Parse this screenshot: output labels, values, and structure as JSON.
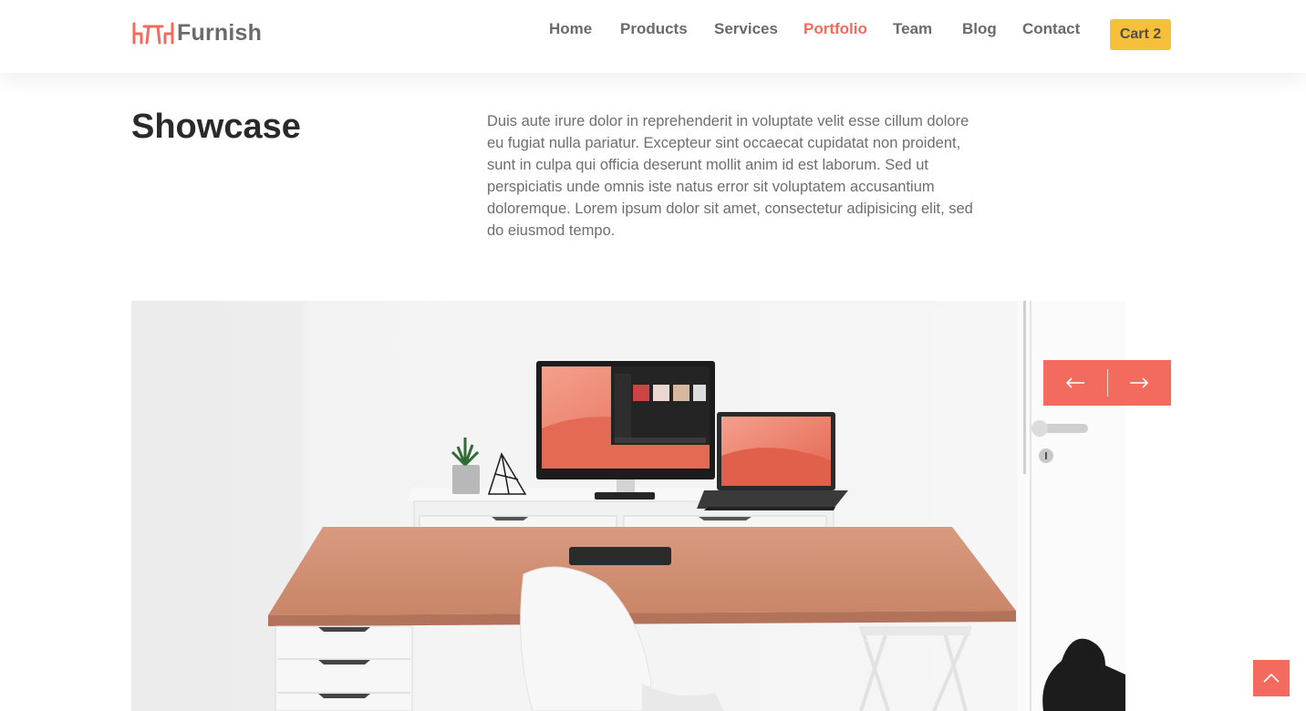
{
  "brand": {
    "name": "Furnish",
    "accent_color": "#f26b5e"
  },
  "nav": {
    "items": [
      {
        "label": "Home",
        "active": false
      },
      {
        "label": "Products",
        "active": false
      },
      {
        "label": "Services",
        "active": false
      },
      {
        "label": "Portfolio",
        "active": true
      },
      {
        "label": "Team",
        "active": false
      },
      {
        "label": "Blog",
        "active": false
      },
      {
        "label": "Contact",
        "active": false
      }
    ],
    "cart_label": "Cart 2",
    "cart_color": "#f7bf3a"
  },
  "section": {
    "title": "Showcase",
    "description": "Duis aute irure dolor in reprehenderit in voluptate velit esse cillum dolore eu fugiat nulla pariatur. Excepteur sint occaecat cupidatat non proident, sunt in culpa qui officia deserunt mollit anim id est laborum. Sed ut perspiciatis unde omnis iste natus error sit voluptatem accusantium doloremque. Lorem ipsum dolor sit amet, consectetur adipisicing elit, sed do eiusmod tempo."
  },
  "slider": {
    "prev_icon": "arrow-left-icon",
    "next_icon": "arrow-right-icon"
  },
  "scroll_top": {
    "icon": "chevron-up-icon"
  }
}
